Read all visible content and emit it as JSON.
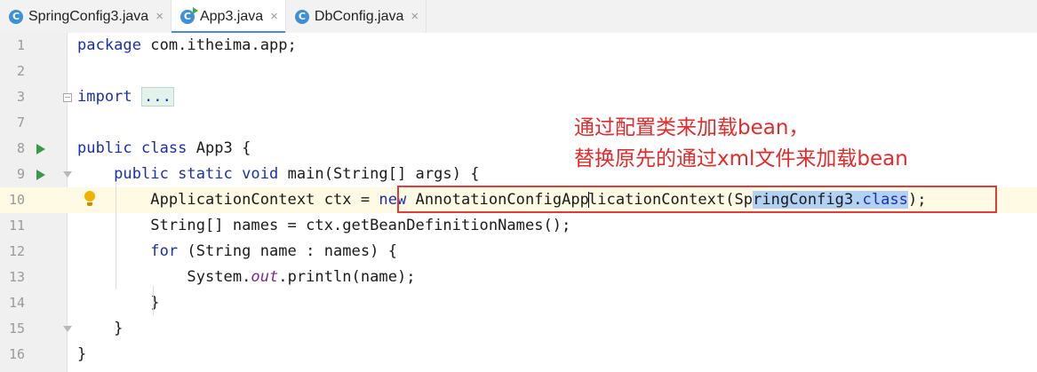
{
  "tabs": [
    {
      "icon": "C",
      "label": "SpringConfig3.java",
      "close": "×",
      "active": false,
      "runnable": false
    },
    {
      "icon": "C",
      "label": "App3.java",
      "close": "×",
      "active": true,
      "runnable": true
    },
    {
      "icon": "C",
      "label": "DbConfig.java",
      "close": "×",
      "active": false,
      "runnable": false
    }
  ],
  "lines": [
    {
      "n": "1",
      "code": [
        {
          "t": "package ",
          "c": "kw"
        },
        {
          "t": "com.itheima.app;"
        }
      ]
    },
    {
      "n": "2",
      "code": []
    },
    {
      "n": "3",
      "code": [
        {
          "t": "import ",
          "c": "kw"
        },
        {
          "t": "...",
          "c": "folded"
        }
      ]
    },
    {
      "n": "7",
      "code": []
    },
    {
      "n": "8",
      "code": [
        {
          "t": "public class ",
          "c": "kw"
        },
        {
          "t": "App3 {"
        }
      ]
    },
    {
      "n": "9",
      "code": [
        {
          "t": "    "
        },
        {
          "t": "public static void ",
          "c": "kw"
        },
        {
          "t": "main(String[] args) {"
        }
      ]
    },
    {
      "n": "10",
      "code": [
        {
          "t": "        ApplicationContext ctx = "
        },
        {
          "t": "new ",
          "c": "kw"
        },
        {
          "t": "AnnotationConfigApp"
        },
        {
          "t": "",
          "c": "caret"
        },
        {
          "t": "licationContext(Sp"
        },
        {
          "t": "ringConfig3.",
          "c": "sel"
        },
        {
          "t": "class",
          "c": "kw sel"
        },
        {
          "t": ");"
        }
      ]
    },
    {
      "n": "11",
      "code": [
        {
          "t": "        String[] names = ctx.getBeanDefinitionNames();"
        }
      ]
    },
    {
      "n": "12",
      "code": [
        {
          "t": "        "
        },
        {
          "t": "for ",
          "c": "kw"
        },
        {
          "t": "(String name : names) {"
        }
      ]
    },
    {
      "n": "13",
      "code": [
        {
          "t": "            System."
        },
        {
          "t": "out",
          "c": "italic"
        },
        {
          "t": ".println(name);"
        }
      ]
    },
    {
      "n": "14",
      "code": [
        {
          "t": "        }"
        }
      ]
    },
    {
      "n": "15",
      "code": [
        {
          "t": "    }"
        }
      ]
    },
    {
      "n": "16",
      "code": [
        {
          "t": "}"
        }
      ]
    }
  ],
  "annotation": {
    "line1": "通过配置类来加载bean，",
    "line2": "替换原先的通过xml文件来加载bean"
  },
  "colors": {
    "keyword": "#1a2fb0",
    "annotation": "#e42a2a",
    "highlight_box": "#e23b3b",
    "selection": "#b3d1f5"
  }
}
